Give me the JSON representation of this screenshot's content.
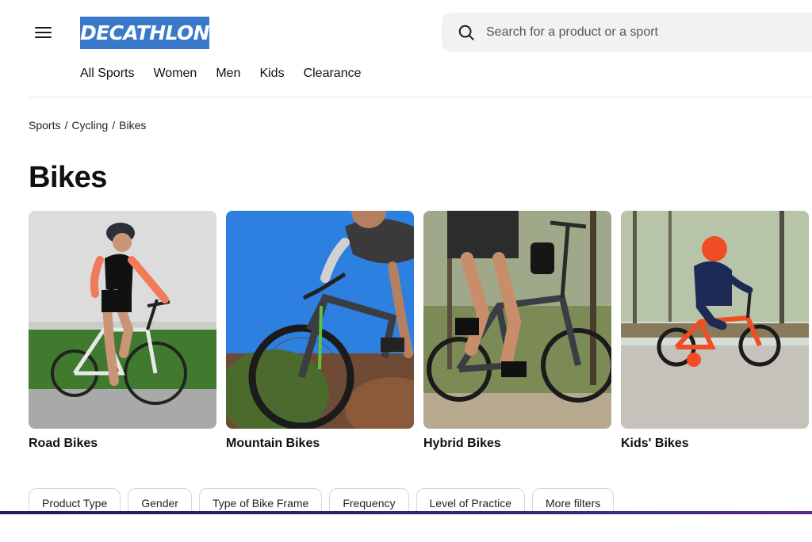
{
  "header": {
    "logo_text": "DECATHLON",
    "logo_color": "#3a78c9",
    "menu_icon": "hamburger-menu-icon",
    "search": {
      "placeholder": "Search for a product or a sport",
      "icon": "search-icon"
    }
  },
  "nav": {
    "items": [
      "All Sports",
      "Women",
      "Men",
      "Kids",
      "Clearance"
    ]
  },
  "breadcrumb": [
    "Sports",
    "Cycling",
    "Bikes"
  ],
  "page": {
    "title": "Bikes"
  },
  "categories": [
    {
      "label": "Road Bikes"
    },
    {
      "label": "Mountain Bikes"
    },
    {
      "label": "Hybrid Bikes"
    },
    {
      "label": "Kids' Bikes"
    }
  ],
  "filters": [
    "Product Type",
    "Gender",
    "Type of Bike Frame",
    "Frequency",
    "Level of Practice",
    "More filters"
  ],
  "colors": {
    "accent": "#3a78c9",
    "footer_line": "#2b2c6e"
  }
}
